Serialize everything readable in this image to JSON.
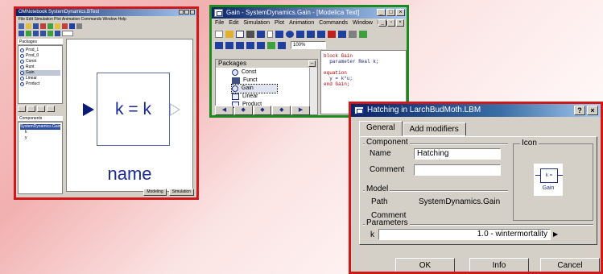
{
  "window1": {
    "title": "OMNotebook SystemDynamics.BTest",
    "menubar": "File Edit Simulation Plot Animation Commands Window Help",
    "packages_header": "Packages",
    "package_items": [
      "Prod_1",
      "Prod_0",
      "Const",
      "Runt",
      "Gain",
      "Linear",
      "Product"
    ],
    "components_header": "Components",
    "component_items": [
      "SystemDynamics.Gain",
      "k",
      "y"
    ],
    "block_text": "k = k",
    "block_name": "name",
    "status_buttons": [
      "Modeling",
      "Simulation"
    ]
  },
  "window2": {
    "title": "Gain - SystemDynamics.Gain - [Modelica Text]",
    "menus": [
      "File",
      "Edit",
      "Simulation",
      "Plot",
      "Animation",
      "Commands",
      "Window",
      "Help"
    ],
    "zoom": "100%",
    "packages_header": "Packages",
    "tree_items": [
      {
        "label": "Const",
        "icon": "circle-icon"
      },
      {
        "label": "Funct",
        "icon": "function-icon"
      },
      {
        "label": "Gain",
        "icon": "circle-icon"
      },
      {
        "label": "Linear",
        "icon": "block-icon"
      },
      {
        "label": "Product",
        "icon": "block-icon"
      }
    ],
    "code_lines": [
      "block Gain",
      "  parameter Real k;",
      "",
      "equation",
      "  y = k*u;",
      "end Gain;"
    ]
  },
  "dialog": {
    "title": "Hatching in LarchBudMoth.LBM",
    "help_button": "?",
    "close_button": "×",
    "tabs": [
      "General",
      "Add modifiers"
    ],
    "component_group": "Component",
    "name_label": "Name",
    "name_value": "Hatching",
    "comment_label": "Comment",
    "comment_value": "",
    "icon_group": "Icon",
    "icon_caption": "Gain",
    "icon_block_text": "k =",
    "model_group": "Model",
    "path_label": "Path",
    "path_value": "SystemDynamics.Gain",
    "model_comment_label": "Comment",
    "parameters_group": "Parameters",
    "param_name": "k",
    "param_value": "1.0 - wintermortality",
    "ok_button": "OK",
    "info_button": "Info",
    "cancel_button": "Cancel"
  }
}
